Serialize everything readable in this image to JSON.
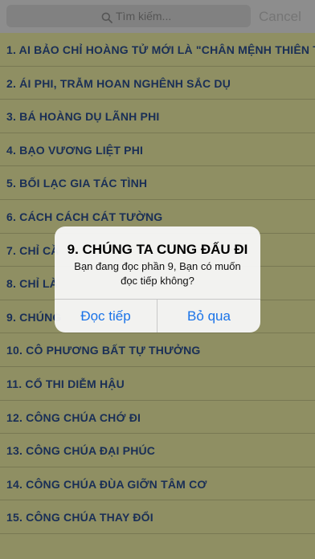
{
  "search": {
    "placeholder": "Tìm kiếm...",
    "cancel_label": "Cancel"
  },
  "list": {
    "items": [
      "1. AI BẢO CHỈ HOÀNG TỬ MỚI LÀ \"CHÂN MỆNH THIÊN TỬ",
      "2. ÁI PHI, TRẪM HOAN NGHÊNH SẮC DỤ",
      "3. BÁ HOÀNG DỤ LÃNH PHI",
      "4. BẠO VƯƠNG LIỆT PHI",
      "5. BỐI LẠC GIA TÁC TÌNH",
      "6. CÁCH CÁCH CÁT TƯỜNG",
      "7. CHỈ CẦ",
      "8. CHỈ LÀ",
      "9. CHÚNG",
      "10. CÔ PHƯƠNG BẤT TỰ THƯỞNG",
      "11. CỔ THI DIỄM HẬU",
      "12. CÔNG CHÚA CHỚ ĐI",
      "13. CÔNG CHÚA ĐẠI PHÚC",
      "14. CÔNG CHÚA ĐÙA GIỠN TÂM CƠ",
      "15. CÔNG CHÚA THAY ĐỔI"
    ]
  },
  "dialog": {
    "title": "9. CHÚNG TA CUNG ĐẤU ĐI",
    "message": "Bạn đang đọc phần 9, Bạn có muốn đọc tiếp không?",
    "continue_label": "Đọc tiếp",
    "skip_label": "Bỏ qua"
  }
}
